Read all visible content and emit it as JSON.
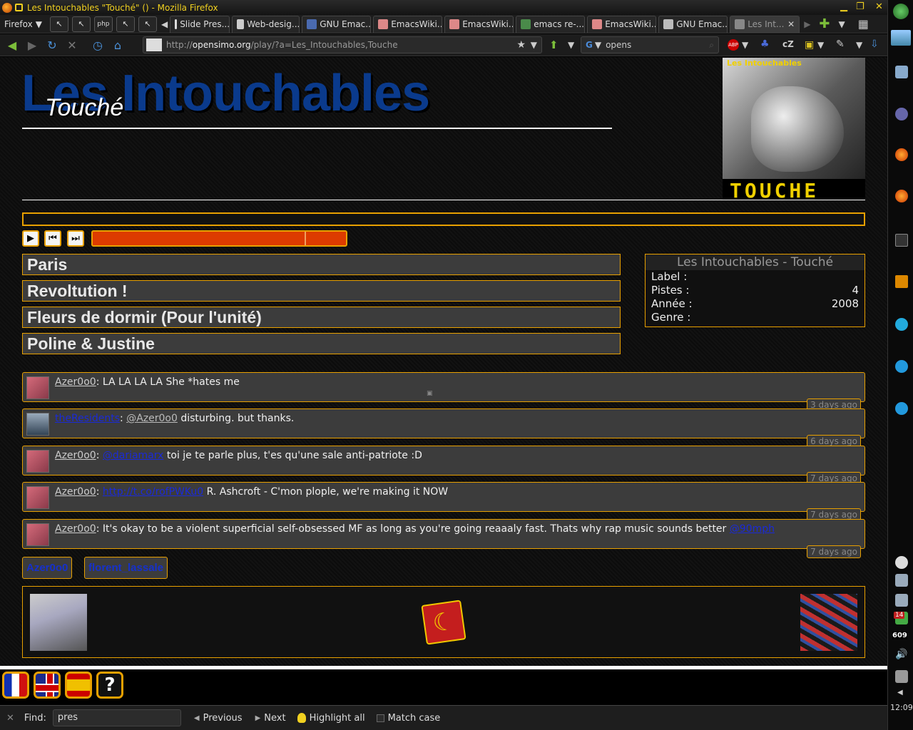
{
  "window": {
    "title": "Les Intouchables \"Touché\" () - Mozilla Firefox"
  },
  "browser": {
    "menu_label": "Firefox",
    "tabs": [
      {
        "label": "Slide Pres..."
      },
      {
        "label": "Web-desig..."
      },
      {
        "label": "GNU Emac..."
      },
      {
        "label": "EmacsWiki..."
      },
      {
        "label": "EmacsWiki..."
      },
      {
        "label": "emacs re-..."
      },
      {
        "label": "EmacsWiki..."
      },
      {
        "label": "GNU Emac..."
      },
      {
        "label": "Les Int..."
      }
    ],
    "url_prefix": "http://",
    "url_host": "opensimo.org",
    "url_path": "/play/?a=Les_Intouchables,Touche",
    "search_text": "opens",
    "toolbar_text_cz": "cZ"
  },
  "page": {
    "band": "Les Intouchables",
    "album": "Touché",
    "cover_band": "Les Intouchables",
    "cover_album": "TOUCHE",
    "tracks": [
      {
        "title": "Paris"
      },
      {
        "title": "Revoltution !"
      },
      {
        "title": "Fleurs de dormir (Pour l'unité)"
      },
      {
        "title": "Poline & Justine"
      }
    ],
    "info": {
      "title": "Les Intouchables - Touché",
      "label_key": "Label :",
      "label_value": "",
      "pistes_key": "Pistes :",
      "pistes_value": "4",
      "annee_key": "Année :",
      "annee_value": "2008",
      "genre_key": "Genre :",
      "genre_value": ""
    },
    "tweets": [
      {
        "user": "Azer0o0",
        "sep": ": ",
        "pre": "",
        "link": "",
        "text": "LA LA LA LA She *hates me",
        "mention": "",
        "time": "3 days ago"
      },
      {
        "user": "theResidents",
        "sep": ": ",
        "pre": "@Azer0o0",
        "link": "",
        "text": " disturbing. but thanks.",
        "mention": "",
        "time": "6 days ago"
      },
      {
        "user": "Azer0o0",
        "sep": ": ",
        "pre": "",
        "link": "@dariamarx",
        "text": " toi je te parle plus, t'es qu'une sale anti-patriote :D",
        "mention": "",
        "time": "7 days ago"
      },
      {
        "user": "Azer0o0",
        "sep": ": ",
        "pre": "",
        "link": "http://t.co/rofPWKu0",
        "text": " R. Ashcroft - C'mon plople, we're making it NOW",
        "mention": "",
        "time": "7 days ago"
      },
      {
        "user": "Azer0o0",
        "sep": ": ",
        "pre": "",
        "link": "",
        "text": "It's okay to be a violent superficial self-obsessed MF as long as you're going reaaaly fast. Thats why rap music sounds better ",
        "mention": "@90mph",
        "time": "7 days ago"
      }
    ],
    "tags": [
      {
        "label": "Azer0o0"
      },
      {
        "label": "florent_lassale"
      }
    ],
    "playback_progress": 0.84
  },
  "findbar": {
    "find_label": "Find:",
    "query": "pres",
    "previous_label": "Previous",
    "next_label": "Next",
    "highlight_label": "Highlight all",
    "matchcase_label": "Match case"
  },
  "panel": {
    "clock": "12:09",
    "badge_count": "14",
    "counter": "609"
  }
}
